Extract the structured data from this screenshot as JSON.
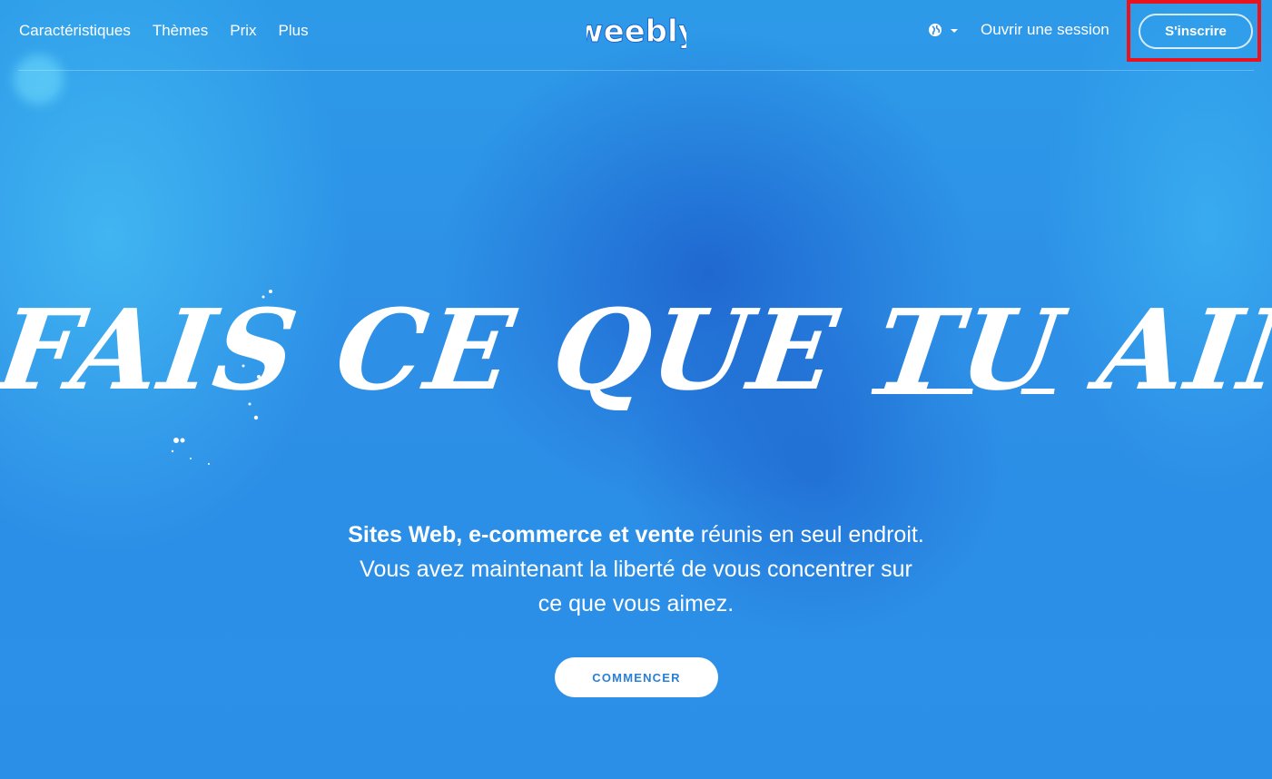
{
  "nav": {
    "items": [
      {
        "label": "Caractéristiques"
      },
      {
        "label": "Thèmes"
      },
      {
        "label": "Prix"
      },
      {
        "label": "Plus"
      }
    ],
    "logo_text": "weebly",
    "language_icon": "globe-icon",
    "language_caret_icon": "caret-down-icon",
    "login_label": "Ouvrir une session",
    "signup_label": "S'inscrire"
  },
  "hero": {
    "headline_part1": "FAIS CE QUE ",
    "headline_tu": "TU",
    "headline_part2": " AIMES",
    "tagline_bold": "Sites Web, e-commerce et vente",
    "tagline_rest": " réunis en seul endroit. Vous avez maintenant la liberté de vous concentrer sur ce que vous aimez.",
    "cta_label": "COMMENCER"
  },
  "colors": {
    "background": "#2a8fe8",
    "accent_text": "#2a7fd6",
    "highlight_border": "#e8131e"
  }
}
